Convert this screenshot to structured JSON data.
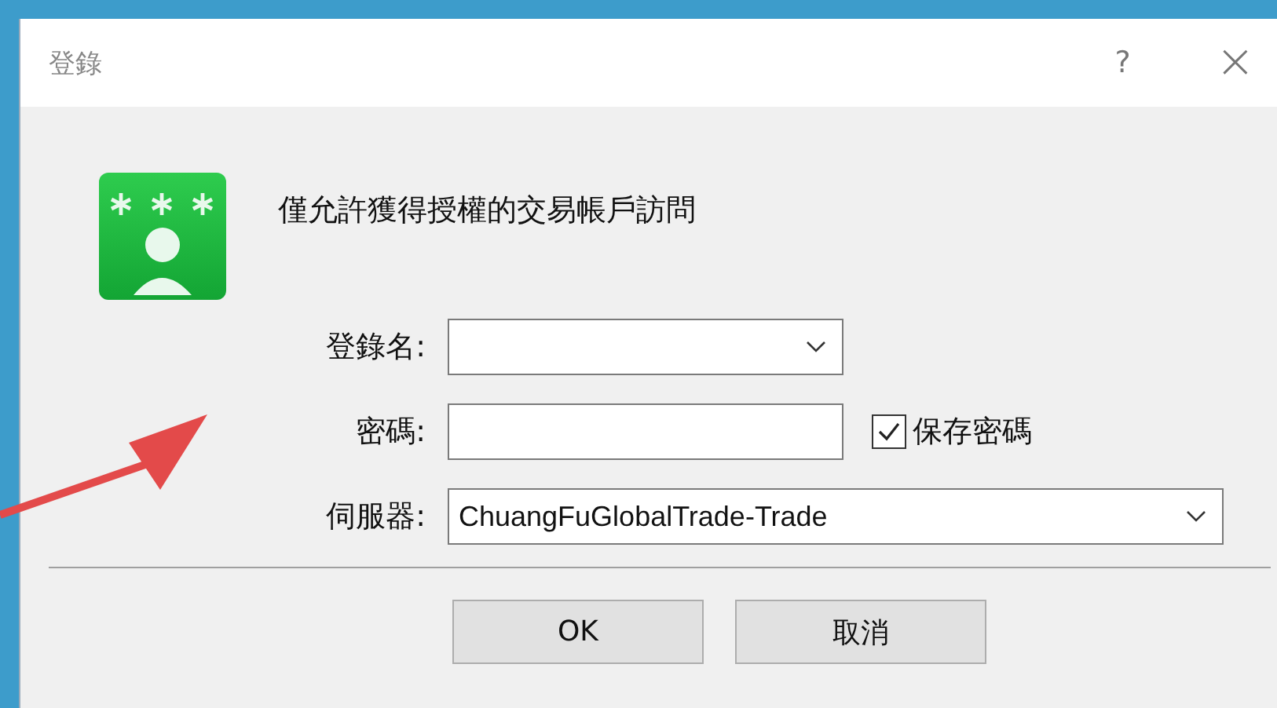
{
  "window": {
    "title": "登錄",
    "help": "?",
    "close": "×"
  },
  "message": "僅允許獲得授權的交易帳戶訪問",
  "fields": [
    {
      "kind": "combo",
      "label": "登錄名:"
    },
    {
      "kind": "text",
      "label": "密碼:",
      "checkbox": {
        "label": "保存密碼",
        "checked": true
      }
    },
    {
      "kind": "combo",
      "label": "伺服器:",
      "value": "ChuangFuGlobalTrade-Trade"
    }
  ],
  "buttons": [
    "OK",
    "取消"
  ]
}
